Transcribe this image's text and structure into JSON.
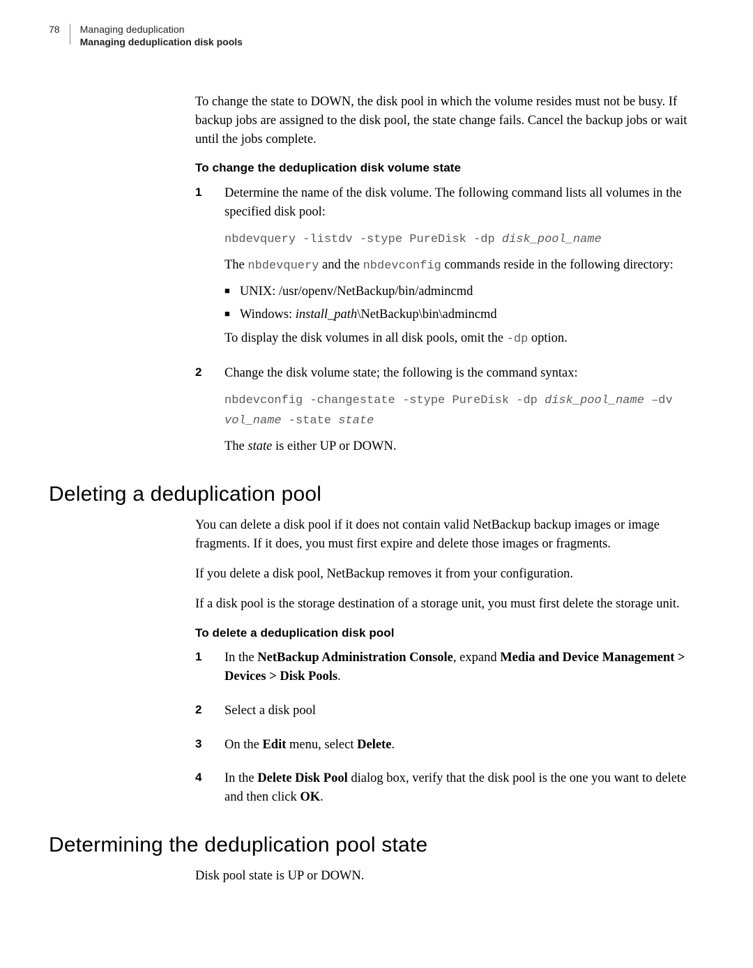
{
  "header": {
    "pageNum": "78",
    "line1": "Managing deduplication",
    "line2": "Managing deduplication disk pools"
  },
  "intro": "To change the state to DOWN, the disk pool in which the volume resides must not be busy. If backup jobs are assigned to the disk pool, the state change fails. Cancel the backup jobs or wait until the jobs complete.",
  "sec1": {
    "heading": "To change the deduplication disk volume state",
    "step1": {
      "num": "1",
      "p1": "Determine the name of the disk volume. The following command lists all volumes in the specified disk pool:",
      "code1a": "nbdevquery -listdv -stype PureDisk -dp ",
      "code1b": "disk_pool_name",
      "p2a": "The ",
      "p2b": "nbdevquery",
      "p2c": " and the ",
      "p2d": "nbdevconfig",
      "p2e": " commands reside in the following directory:",
      "b1": "UNIX: /usr/openv/NetBackup/bin/admincmd",
      "b2a": "Windows: ",
      "b2b": "install_path",
      "b2c": "\\NetBackup\\bin\\admincmd",
      "p3a": "To display the disk volumes in all disk pools, omit the ",
      "p3b": "-dp",
      "p3c": " option."
    },
    "step2": {
      "num": "2",
      "p1": "Change the disk volume state; the following is the command syntax:",
      "c1": "nbdevconfig -changestate -stype PureDisk -dp ",
      "c2": "disk_pool_name",
      "c3": " –dv",
      "c4": "vol_name",
      "c5": " -state ",
      "c6": "state",
      "p2a": "The ",
      "p2b": "state",
      "p2c": " is either UP or DOWN."
    }
  },
  "sec2": {
    "title": "Deleting a deduplication pool",
    "p1": "You can delete a disk pool if it does not contain valid NetBackup backup images or image fragments. If it does, you must first expire and delete those images or fragments.",
    "p2": "If you delete a disk pool, NetBackup removes it from your configuration.",
    "p3": "If a disk pool is the storage destination of a storage unit, you must first delete the storage unit.",
    "heading": "To delete a deduplication disk pool",
    "s1": {
      "num": "1",
      "a": "In the ",
      "b": "NetBackup Administration Console",
      "c": ", expand ",
      "d": "Media and Device Management > Devices > Disk Pools",
      "e": "."
    },
    "s2": {
      "num": "2",
      "a": "Select a disk pool"
    },
    "s3": {
      "num": "3",
      "a": "On the ",
      "b": "Edit",
      "c": " menu, select ",
      "d": "Delete",
      "e": "."
    },
    "s4": {
      "num": "4",
      "a": "In the ",
      "b": "Delete Disk Pool",
      "c": " dialog box, verify that the disk pool is the one you want to delete and then click ",
      "d": "OK",
      "e": "."
    }
  },
  "sec3": {
    "title": "Determining the deduplication pool state",
    "p1": "Disk pool state is UP or DOWN."
  }
}
